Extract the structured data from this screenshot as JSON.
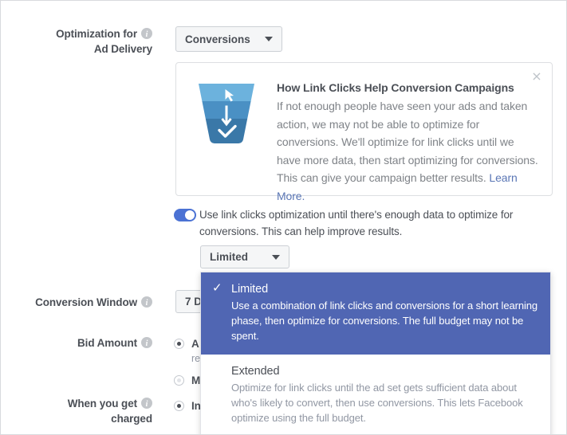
{
  "fields": {
    "optimization": {
      "label_line1": "Optimization for",
      "label_line2": "Ad Delivery",
      "value": "Conversions"
    },
    "conversion_window": {
      "label": "Conversion Window",
      "value": "7 D"
    },
    "bid_amount": {
      "label": "Bid Amount",
      "option_auto": "A",
      "option_auto_sub": "re",
      "option_manual": "M"
    },
    "when_charged": {
      "label": "When you get",
      "label_line2": "charged",
      "option": "In"
    }
  },
  "card": {
    "title": "How Link Clicks Help Conversion Campaigns",
    "body": "If not enough people have seen your ads and taken action, we may not be able to optimize for conversions. We'll optimize for link clicks until we have more data, then start optimizing for conversions. This can give your campaign better results. ",
    "link": "Learn More.",
    "close_label": "×",
    "icon": "conversion-funnel-icon"
  },
  "toggle": {
    "state": "on",
    "label": "Use link clicks optimization until there's enough data to optimize for conversions. This can help improve results."
  },
  "learning_phase": {
    "selected_value": "Limited",
    "options": [
      {
        "title": "Limited",
        "description": "Use a combination of link clicks and conversions for a short learning phase, then optimize for conversions. The full budget may not be spent.",
        "selected": true,
        "check": "✓"
      },
      {
        "title": "Extended",
        "description": "Optimize for link clicks until the ad set gets sufficient data about who's likely to convert, then use conversions. This lets Facebook optimize using the full budget.",
        "selected": false,
        "check": ""
      }
    ]
  },
  "colors": {
    "highlight": "#5066b3",
    "toggle_on": "#4b72d4",
    "link": "#5a76b5",
    "text_primary": "#4b4f56",
    "text_muted": "#9197a3",
    "funnel_light": "#6cb2dd",
    "funnel_mid": "#4a90c4",
    "funnel_dark": "#3a78a8"
  }
}
